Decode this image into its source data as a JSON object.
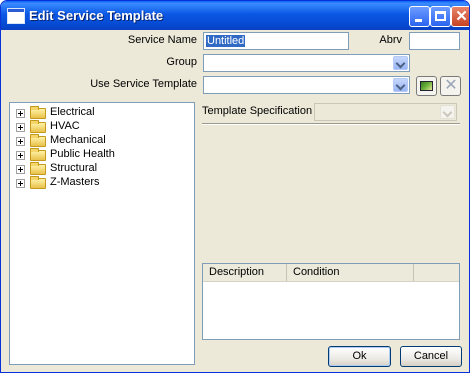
{
  "window": {
    "title": "Edit Service Template"
  },
  "form": {
    "service_name_label": "Service Name",
    "service_name_value": "Untitled",
    "abrv_label": "Abrv",
    "abrv_value": "",
    "group_label": "Group",
    "group_value": "",
    "use_template_label": "Use Service Template",
    "use_template_value": "",
    "template_spec_label": "Template Specification",
    "template_spec_value": ""
  },
  "tree": {
    "items": [
      {
        "label": "Electrical"
      },
      {
        "label": "HVAC"
      },
      {
        "label": "Mechanical"
      },
      {
        "label": "Public Health"
      },
      {
        "label": "Structural"
      },
      {
        "label": "Z-Masters"
      }
    ]
  },
  "grid": {
    "columns": [
      "Description",
      "Condition"
    ]
  },
  "buttons": {
    "ok": "Ok",
    "cancel": "Cancel"
  }
}
